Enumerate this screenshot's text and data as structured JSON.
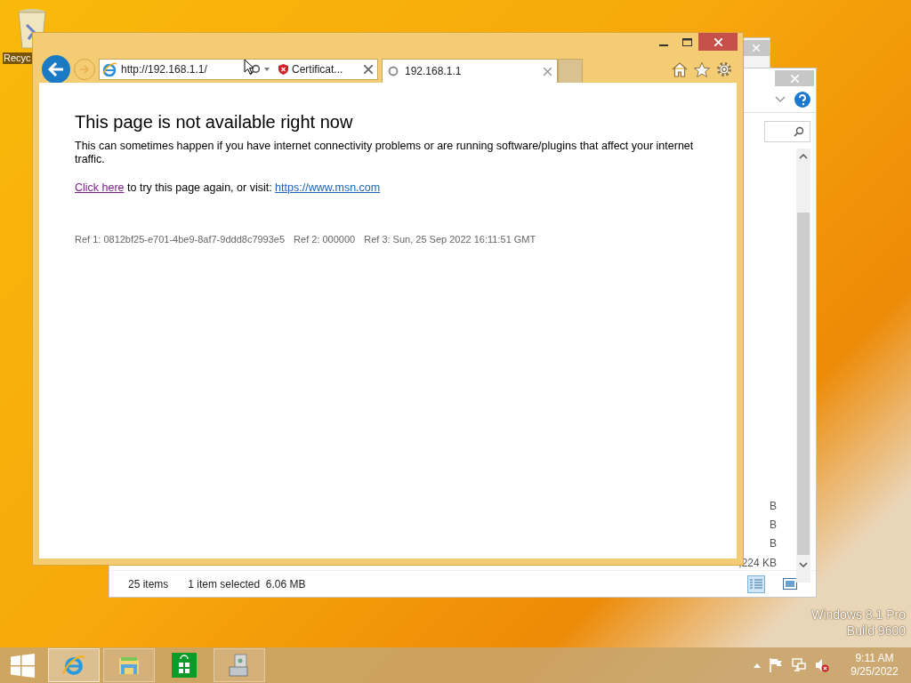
{
  "desktop": {
    "icon_label": "Recyc",
    "watermark": [
      "Windows 8.1 Pro",
      "Build 9600"
    ]
  },
  "explorer": {
    "size_fragments": [
      "B",
      "B",
      "B"
    ],
    "last_size": ",224 KB",
    "status": [
      "25 items",
      "1 item selected  6.06 MB"
    ]
  },
  "browser": {
    "address": "http://192.168.1.1/",
    "certificate": "Certificat...",
    "tabs": [
      {
        "label": "192.168.1.1",
        "selected": true
      }
    ],
    "page": {
      "heading": "This page is not available right now",
      "body": "This can sometimes happen if you have internet connectivity problems or are running software/plugins that affect your internet traffic.",
      "retry_link": "Click here",
      "retry_text": "to try this page again, or visit:",
      "msn_link": "https://www.msn.com",
      "refs": [
        "Ref 1: 0812bf25-e701-4be9-8af7-9ddd8c7993e5",
        "Ref 2: 000000",
        "Ref 3: Sun, 25 Sep 2022 16:11:51 GMT"
      ]
    }
  },
  "taskbar": {
    "apps": [
      {
        "kind": "ie",
        "selected": true
      },
      {
        "kind": "explorer",
        "selected": false
      },
      {
        "kind": "store",
        "selected": false
      },
      {
        "kind": "app",
        "selected": false
      }
    ],
    "time": "9:11 AM",
    "date": "9/25/2022"
  }
}
